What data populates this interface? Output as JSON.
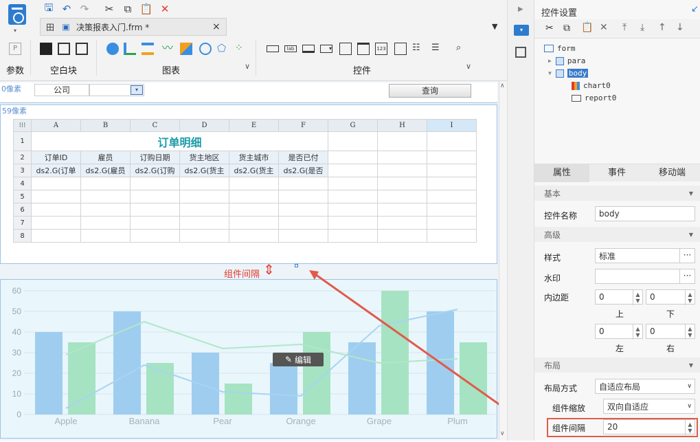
{
  "toolbar": {
    "tab_icon_label": "田",
    "file_tab": "决策报表入门.frm *",
    "close": "×",
    "groups": {
      "param": "参数",
      "blank": "空白块",
      "chart": "图表",
      "widget": "控件"
    }
  },
  "para": {
    "margin_label": "0像素",
    "company_label": "公司",
    "query_button": "查询"
  },
  "report": {
    "margin_label": "59像素",
    "col_headers": [
      "A",
      "B",
      "C",
      "D",
      "E",
      "F",
      "G",
      "H",
      "I"
    ],
    "rows": [
      "1",
      "2",
      "3",
      "4",
      "5",
      "6",
      "7",
      "8"
    ],
    "title": "订单明细",
    "headers": [
      "订单ID",
      "雇员",
      "订购日期",
      "货主地区",
      "货主城市",
      "是否已付"
    ],
    "bindings": [
      "ds2.G(订单",
      "ds2.G(雇员",
      "ds2.G(订购",
      "ds2.G(货主",
      "ds2.G(货主",
      "ds2.G(是否"
    ]
  },
  "gap_label": "组件间隔",
  "edit_button": "编辑",
  "chart_data": {
    "type": "bar",
    "categories": [
      "Apple",
      "Banana",
      "Pear",
      "Orange",
      "Grape",
      "Plum"
    ],
    "ylim": [
      0,
      60
    ],
    "yticks": [
      "0",
      "10",
      "20",
      "30",
      "40",
      "50",
      "60"
    ],
    "series": [
      {
        "values": [
          40,
          50,
          30,
          25,
          35,
          50
        ],
        "color": "#9fcdf0"
      },
      {
        "values": [
          35,
          25,
          15,
          40,
          60,
          35
        ],
        "color": "#a6e3c2"
      }
    ],
    "lines": [
      {
        "values": [
          3,
          24,
          11,
          9,
          43,
          51
        ],
        "color": "#a8d4f0"
      },
      {
        "values": [
          29,
          45,
          32,
          34,
          25,
          27
        ],
        "color": "#b2e6c9"
      }
    ],
    "grid": true
  },
  "panel": {
    "title": "控件设置",
    "tree": [
      "form",
      "para",
      "body",
      "chart0",
      "report0"
    ],
    "tabs": [
      "属性",
      "事件",
      "移动端"
    ],
    "sec_basic": "基本",
    "name_label": "控件名称",
    "name_value": "body",
    "sec_advanced": "高级",
    "style_label": "样式",
    "style_value": "标准",
    "watermark_label": "水印",
    "padding_label": "内边距",
    "pad_top": "0",
    "pad_bottom": "0",
    "pad_left": "0",
    "pad_right": "0",
    "top": "上",
    "bottom": "下",
    "left": "左",
    "right": "右",
    "sec_layout": "布局",
    "layout_label": "布局方式",
    "layout_value": "自适应布局",
    "scale_label": "组件缩放",
    "scale_value": "双向自适应",
    "gap_label": "组件间隔",
    "gap_value": "20"
  }
}
